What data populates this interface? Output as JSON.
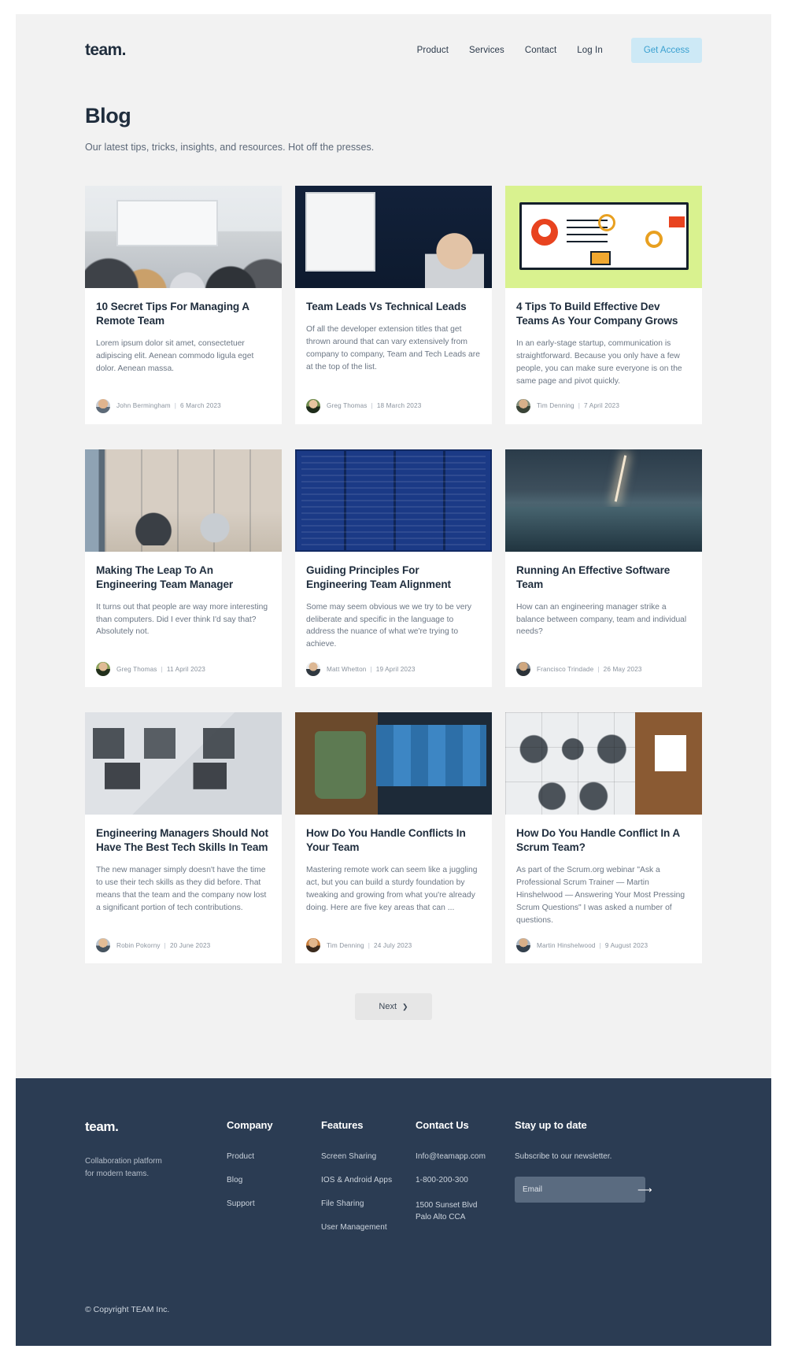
{
  "header": {
    "logo": "team.",
    "nav": [
      {
        "label": "Product"
      },
      {
        "label": "Services"
      },
      {
        "label": "Contact"
      },
      {
        "label": "Log In"
      }
    ],
    "cta_label": "Get Access",
    "cta_bg": "#cde9f6",
    "cta_color": "#3aa0d0"
  },
  "intro": {
    "title": "Blog",
    "subtitle": "Our latest tips, tricks, insights, and resources. Hot off the presses."
  },
  "posts": [
    {
      "title": "10 Secret Tips For Managing A Remote Team",
      "excerpt": "Lorem ipsum dolor sit amet, consectetuer adipiscing elit. Aenean commodo ligula eget dolor. Aenean massa.",
      "author": "John Bermingham",
      "date": "6 March 2023",
      "thumb": "meeting-room-photo"
    },
    {
      "title": "Team Leads Vs Technical Leads",
      "excerpt": "Of all the developer extension titles that get thrown around that can vary extensively from company to company, Team and Tech Leads are at the top of the list.",
      "author": "Greg Thomas",
      "date": "18 March 2023",
      "thumb": "speaker-whiteboard-photo"
    },
    {
      "title": "4 Tips To Build Effective Dev Teams As Your Company Grows",
      "excerpt": "In an early-stage startup, communication is straightforward. Because you only have a few people, you can make sure everyone is on the same page and pivot quickly.",
      "author": "Tim Denning",
      "date": "7 April 2023",
      "thumb": "workflow-illustration"
    },
    {
      "title": "Making The Leap To An Engineering Team Manager",
      "excerpt": "It turns out that people are way more interesting than computers. Did I ever think I'd say that? Absolutely not.",
      "author": "Greg Thomas",
      "date": "11 April 2023",
      "thumb": "office-lounge-photo"
    },
    {
      "title": "Guiding Principles For Engineering Team Alignment",
      "excerpt": "Some may seem obvious we we try to be very deliberate and specific in the language to address the nuance of what we're trying to achieve.",
      "author": "Matt Whetton",
      "date": "19 April 2023",
      "thumb": "principles-grid-graphic"
    },
    {
      "title": "Running An Effective Software Team",
      "excerpt": "How can an engineering manager strike a balance between company, team and individual needs?",
      "author": "Francisco Trindade",
      "date": "26 May 2023",
      "thumb": "lightning-sea-photo"
    },
    {
      "title": "Engineering Managers Should Not Have The Best Tech Skills In Team",
      "excerpt": "The new manager simply doesn't have the time to use their tech skills as they did before. That means that the team and the company now lost a significant portion of tech contributions.",
      "author": "Robin Pokorny",
      "date": "20 June 2023",
      "thumb": "desk-laptops-photo"
    },
    {
      "title": "How Do You Handle Conflicts In Your Team",
      "excerpt": "Mastering remote work can seem like a juggling act, but you can build a sturdy foundation by tweaking and growing from what you're already doing. Here are five key areas that can ...",
      "author": "Tim Denning",
      "date": "24 July 2023",
      "thumb": "video-call-mug-photo"
    },
    {
      "title": "How Do You Handle Conflict In A Scrum Team?",
      "excerpt": "As part of the Scrum.org webinar \"Ask a Professional Scrum Trainer — Martin Hinshelwood — Answering Your Most Pressing Scrum Questions\" I was asked a number of questions.",
      "author": "Martin Hinshelwood",
      "date": "9 August 2023",
      "thumb": "puzzle-people-photo"
    }
  ],
  "pagination": {
    "next_label": "Next",
    "next_icon": "chevron-right-icon"
  },
  "footer": {
    "logo": "team.",
    "tagline": "Collaboration platform\nfor modern teams.",
    "tagline_line1": "Collaboration platform",
    "tagline_line2": "for modern teams.",
    "columns": [
      {
        "heading": "Company",
        "links": [
          "Product",
          "Blog",
          "Support"
        ]
      },
      {
        "heading": "Features",
        "links": [
          "Screen Sharing",
          "IOS & Android Apps",
          "File Sharing",
          "User Management"
        ]
      }
    ],
    "contact": {
      "heading": "Contact Us",
      "email": "Info@teamapp.com",
      "phone": "1-800-200-300",
      "address_line1": "1500 Sunset Blvd",
      "address_line2": "Palo Alto CCA"
    },
    "newsletter": {
      "heading": "Stay up to date",
      "note": "Subscribe to our newsletter.",
      "placeholder": "Email",
      "value": "",
      "submit_icon": "arrow-right-icon"
    },
    "copyright": "© Copyright TEAM Inc.",
    "bg": "#2b3c53"
  }
}
